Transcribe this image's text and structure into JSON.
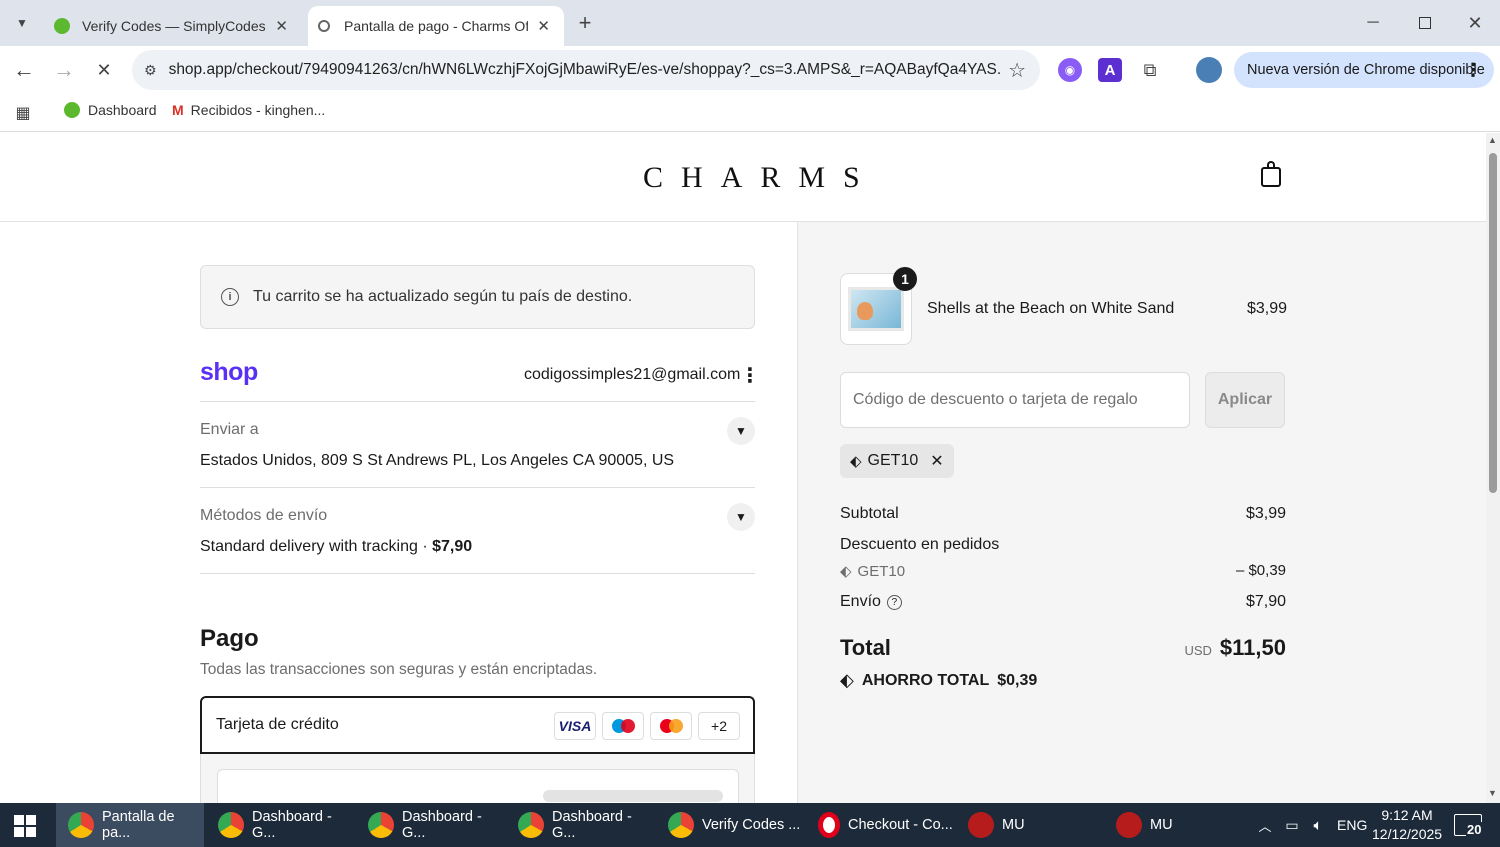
{
  "browser": {
    "tabs": [
      {
        "title": "Verify Codes — SimplyCodes",
        "active": false
      },
      {
        "title": "Pantalla de pago - Charms Offic",
        "active": true
      }
    ],
    "url": "shop.app/checkout/79490941263/cn/hWN6LWczhjFXojGjMbawiRyE/es-ve/shoppay?_cs=3.AMPS&_r=AQABayfQa4YAS...",
    "update_label": "Nueva versión de Chrome disponible",
    "bookmarks": [
      "Dashboard",
      "Recibidos - kinghen..."
    ]
  },
  "store": {
    "logo": "CHARMS"
  },
  "checkout": {
    "notice": "Tu carrito se ha actualizado según tu país de destino.",
    "shop_logo": "shop",
    "email": "codigossimples21@gmail.com",
    "ship_to_label": "Enviar a",
    "ship_to_value": "Estados Unidos, 809 S St Andrews PL, Los Angeles CA 90005, US",
    "shipping_method_label": "Métodos de envío",
    "shipping_method_value": "Standard delivery with tracking",
    "shipping_method_price": "$7,90",
    "shipping_method_sep": " · ",
    "payment_title": "Pago",
    "payment_subtitle": "Todas las transacciones son seguras y están encriptadas.",
    "credit_card_label": "Tarjeta de crédito",
    "card_logos": [
      "VISA",
      "maestro",
      "mastercard",
      "+2"
    ]
  },
  "summary": {
    "item_qty": "1",
    "item_name": "Shells at the Beach on White Sand",
    "item_price": "$3,99",
    "discount_placeholder": "Código de descuento o tarjeta de regalo",
    "apply_label": "Aplicar",
    "applied_code": "GET10",
    "subtotal_label": "Subtotal",
    "subtotal_value": "$3,99",
    "order_discount_label": "Descuento en pedidos",
    "discount_code": "GET10",
    "discount_value": "– $0,39",
    "shipping_label": "Envío",
    "shipping_value": "$7,90",
    "total_label": "Total",
    "total_currency": "USD",
    "total_value": "$11,50",
    "savings_label": "AHORRO TOTAL",
    "savings_value": "$0,39"
  },
  "taskbar": {
    "items": [
      "Pantalla de pa...",
      "Dashboard - G...",
      "Dashboard - G...",
      "Dashboard - G...",
      "Verify Codes ...",
      "Checkout - Co...",
      "MU",
      "MU"
    ],
    "lang": "ENG",
    "time": "9:12 AM",
    "date": "12/12/2025",
    "notifications": "20"
  },
  "colors": {
    "shop_purple": "#5a31f4",
    "chrome_tab_bg": "#dfe3eb",
    "taskbar_bg": "#1c2a3a"
  }
}
